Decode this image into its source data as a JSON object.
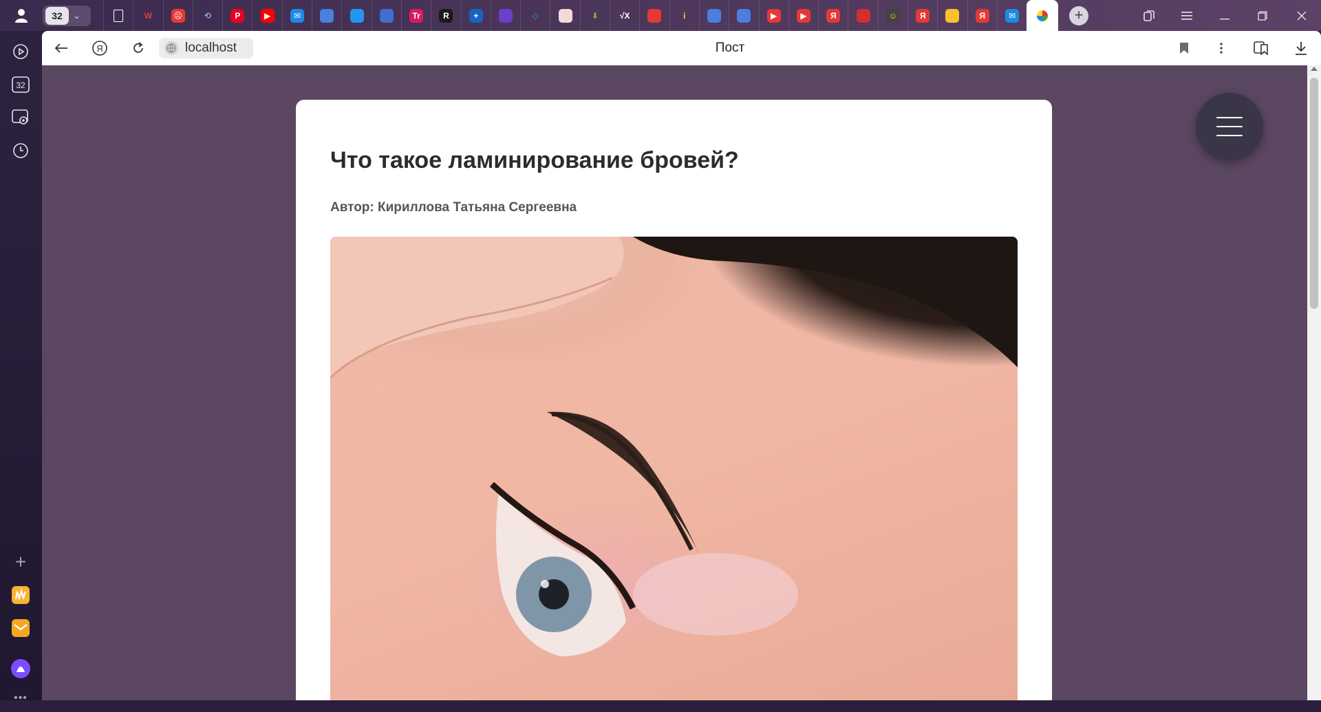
{
  "browser": {
    "tab_count": "32",
    "address_host": "localhost",
    "page_title": "Пост"
  },
  "pinned_tabs": [
    {
      "name": "doc",
      "label": "",
      "color": "#00000000",
      "fg": "#ffffff"
    },
    {
      "name": "w",
      "label": "W",
      "color": "#00000000",
      "fg": "#e53935"
    },
    {
      "name": "red-face",
      "label": "☹",
      "color": "#e53935",
      "fg": "#ffffff"
    },
    {
      "name": "loading",
      "label": "⟲",
      "color": "#00000000",
      "fg": "#7fb0ff"
    },
    {
      "name": "pinterest",
      "label": "P",
      "color": "#e60023",
      "fg": "#ffffff"
    },
    {
      "name": "youtube",
      "label": "▶",
      "color": "#ff0000",
      "fg": "#ffffff"
    },
    {
      "name": "chat",
      "label": "✉",
      "color": "#1e88e5",
      "fg": "#ffffff"
    },
    {
      "name": "cube-blue",
      "label": "",
      "color": "#4a7fe0",
      "fg": "#ffffff"
    },
    {
      "name": "book",
      "label": "",
      "color": "#2196f3",
      "fg": "#ffffff"
    },
    {
      "name": "basket",
      "label": "",
      "color": "#3f6fd1",
      "fg": "#ffffff"
    },
    {
      "name": "tr",
      "label": "Tr",
      "color": "#d81b60",
      "fg": "#ffffff"
    },
    {
      "name": "r",
      "label": "R",
      "color": "#1a1a1a",
      "fg": "#ffffff"
    },
    {
      "name": "plus-circle",
      "label": "+",
      "color": "#1565c0",
      "fg": "#ffffff"
    },
    {
      "name": "purple-chat",
      "label": "",
      "color": "#6a3fc9",
      "fg": "#ffffff"
    },
    {
      "name": "box-green",
      "label": "◇",
      "color": "#00000000",
      "fg": "#26a69a"
    },
    {
      "name": "smile",
      "label": "",
      "color": "#f4d9d9",
      "fg": "#ffffff"
    },
    {
      "name": "download",
      "label": "⬇",
      "color": "#00000000",
      "fg": "#7cb342"
    },
    {
      "name": "sqrt",
      "label": "√X",
      "color": "#00000000",
      "fg": "#ffffff"
    },
    {
      "name": "books",
      "label": "",
      "color": "#e53935",
      "fg": "#ffffff"
    },
    {
      "name": "info",
      "label": "i",
      "color": "#00000000",
      "fg": "#fdd835"
    },
    {
      "name": "cube-2",
      "label": "",
      "color": "#4a7fe0",
      "fg": "#ffffff"
    },
    {
      "name": "cube-3",
      "label": "",
      "color": "#4a7fe0",
      "fg": "#ffffff"
    },
    {
      "name": "video-1",
      "label": "▶",
      "color": "#e53935",
      "fg": "#ffffff"
    },
    {
      "name": "video-2",
      "label": "▶",
      "color": "#e53935",
      "fg": "#ffffff"
    },
    {
      "name": "yandex-1",
      "label": "Я",
      "color": "#e53935",
      "fg": "#ffffff"
    },
    {
      "name": "red-dot",
      "label": "",
      "color": "#d32f2f",
      "fg": "#ffffff"
    },
    {
      "name": "emoji",
      "label": "☺",
      "color": "#424242",
      "fg": "#ffd54f"
    },
    {
      "name": "yandex-2",
      "label": "Я",
      "color": "#e53935",
      "fg": "#ffffff"
    },
    {
      "name": "image",
      "label": "",
      "color": "#fbc02d",
      "fg": "#ffffff"
    },
    {
      "name": "yandex-3",
      "label": "Я",
      "color": "#e53935",
      "fg": "#ffffff"
    },
    {
      "name": "messenger",
      "label": "✉",
      "color": "#1e88e5",
      "fg": "#ffffff"
    },
    {
      "name": "active-site",
      "label": "",
      "color": "#ffffff",
      "fg": "#333333"
    }
  ],
  "sidebar": {
    "more": "•••"
  },
  "post": {
    "title": "Что такое ламинирование бровей?",
    "author": "Автор: Кириллова Татьяна Сергеевна"
  },
  "colors": {
    "page_bg": "#5b4761",
    "card_bg": "#ffffff",
    "fab_bg": "#3a3547"
  }
}
